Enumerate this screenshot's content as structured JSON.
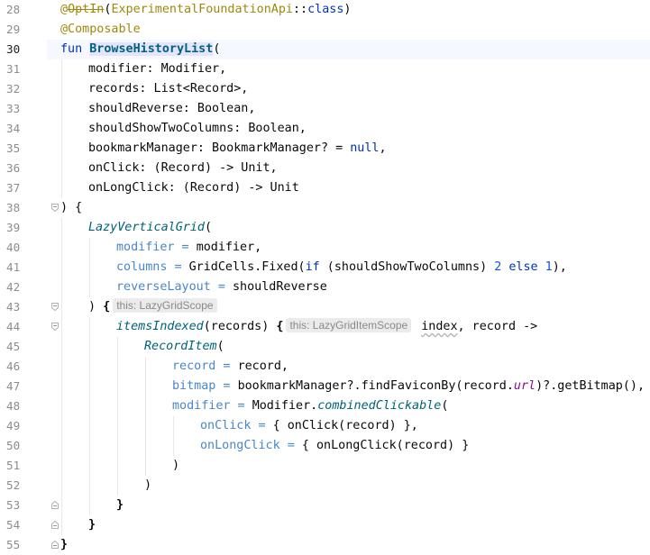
{
  "editor": {
    "current_line": "30",
    "line_numbers": [
      "28",
      "29",
      "30",
      "31",
      "32",
      "33",
      "34",
      "35",
      "36",
      "37",
      "38",
      "39",
      "40",
      "41",
      "42",
      "43",
      "44",
      "45",
      "46",
      "47",
      "48",
      "49",
      "50",
      "51",
      "52",
      "53",
      "54",
      "55"
    ],
    "lines": {
      "l28": {
        "at": "@",
        "optin": "OptIn",
        "open": "(",
        "arg": "ExperimentalFoundationApi",
        "sep": "::",
        "cls": "class",
        "close": ")"
      },
      "l29": {
        "ann": "@Composable"
      },
      "l30": {
        "kw": "fun",
        "name": "BrowseHistoryList",
        "paren": "("
      },
      "l31": {
        "text": "modifier: Modifier,"
      },
      "l32": {
        "text": "records: List<Record>,"
      },
      "l33": {
        "text": "shouldReverse: Boolean,"
      },
      "l34": {
        "text": "shouldShowTwoColumns: Boolean,"
      },
      "l35": {
        "text": "bookmarkManager: BookmarkManager? = ",
        "kw": "null",
        "end": ","
      },
      "l36": {
        "text": "onClick: (Record) -> Unit,"
      },
      "l37": {
        "text": "onLongClick: (Record) -> Unit"
      },
      "l38": {
        "text": ") {"
      },
      "l39": {
        "name": "LazyVerticalGrid",
        "paren": "("
      },
      "l40": {
        "named": "modifier",
        "eq": " = ",
        "text": "modifier,"
      },
      "l41": {
        "named": "columns",
        "eq": " = ",
        "text1": "GridCells.Fixed(",
        "kw1": "if",
        "text2": " (shouldShowTwoColumns) ",
        "num1": "2",
        "sp": " ",
        "kw2": "else",
        "sp2": " ",
        "num2": "1",
        "end": "),"
      },
      "l42": {
        "named": "reverseLayout",
        "eq": " = ",
        "text": "shouldReverse"
      },
      "l43": {
        "text": ") ",
        "brace": "{",
        "hint": "this: LazyGridScope"
      },
      "l44": {
        "name": "itemsIndexed",
        "text": "(records) ",
        "brace": "{",
        "hint": "this: LazyGridItemScope",
        "param": "index",
        "rest": ", record ->"
      },
      "l45": {
        "name": "RecordItem",
        "paren": "("
      },
      "l46": {
        "named": "record",
        "eq": " = ",
        "text": "record,"
      },
      "l47": {
        "named": "bitmap",
        "eq": " = ",
        "text1": "bookmarkManager?.findFaviconBy(record.",
        "prop": "url",
        "text2": ")?.getBitmap(),"
      },
      "l48": {
        "named": "modifier",
        "eq": " = ",
        "text": "Modifier.",
        "name": "combinedClickable",
        "paren": "("
      },
      "l49": {
        "named": "onClick",
        "eq": " = ",
        "text": "{ onClick(record) },"
      },
      "l50": {
        "named": "onLongClick",
        "eq": " = ",
        "text": "{ onLongClick(record) }"
      },
      "l51": {
        "text": ")"
      },
      "l52": {
        "text": ")"
      },
      "l53": {
        "brace": "}"
      },
      "l54": {
        "brace": "}"
      },
      "l55": {
        "brace": "}"
      }
    }
  }
}
